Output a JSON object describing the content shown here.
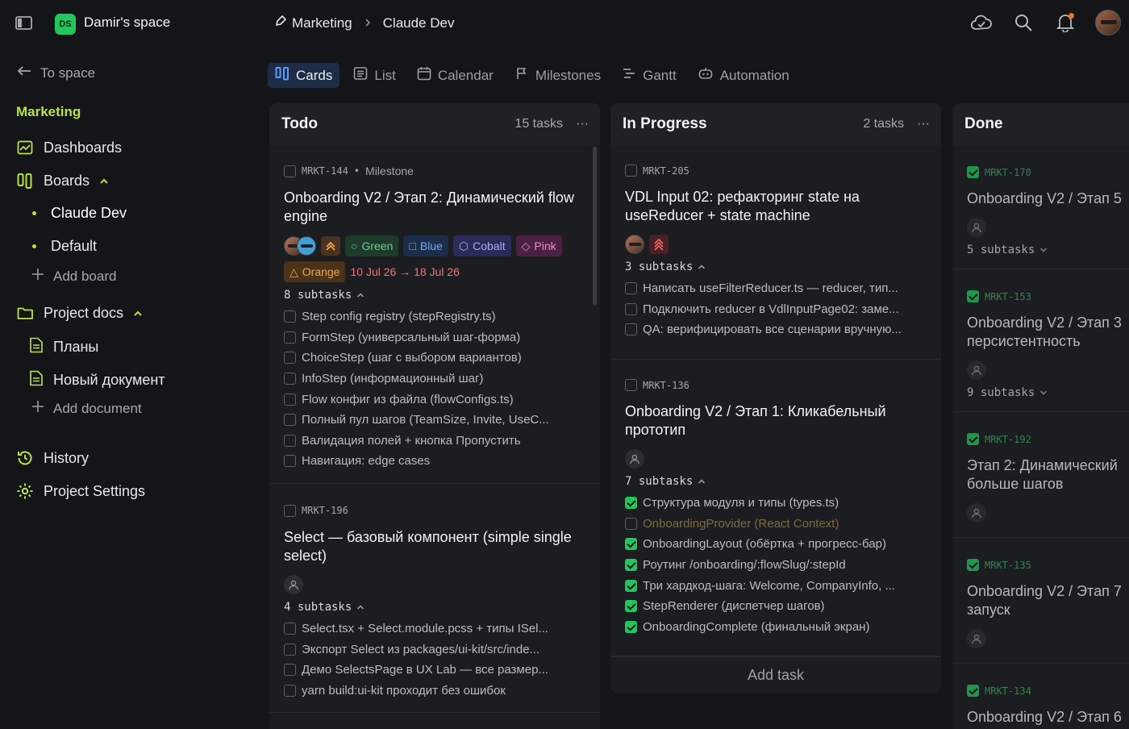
{
  "header": {
    "space_badge": "DS",
    "space_name": "Damir's space",
    "breadcrumb": [
      "Marketing",
      "Claude Dev"
    ]
  },
  "sidebar": {
    "back": "To space",
    "project": "Marketing",
    "dashboards": "Dashboards",
    "boards": "Boards",
    "boards_items": [
      "Claude Dev",
      "Default"
    ],
    "add_board": "Add board",
    "docs": "Project docs",
    "docs_items": [
      "Планы",
      "Новый документ"
    ],
    "add_document": "Add document",
    "history": "History",
    "settings": "Project Settings"
  },
  "tabs": [
    "Cards",
    "List",
    "Calendar",
    "Milestones",
    "Gantt",
    "Automation"
  ],
  "columns": {
    "todo": {
      "title": "Todo",
      "count": "15 tasks",
      "cards": [
        {
          "id": "MRKT-144",
          "milestone": "Milestone",
          "title": "Onboarding V2 / Этап 2: Динамический flow engine",
          "tags": [
            "Green",
            "Blue",
            "Cobalt",
            "Pink",
            "Orange"
          ],
          "dates": "10 Jul 26 → 18 Jul 26",
          "subtasks_label": "8 subtasks",
          "subtasks": [
            "Step config registry (stepRegistry.ts)",
            "FormStep (универсальный шаг-форма)",
            "ChoiceStep (шаг с выбором вариантов)",
            "InfoStep (информационный шаг)",
            "Flow конфиг из файла (flowConfigs.ts)",
            "Полный пул шагов (TeamSize, Invite, UseC...",
            "Валидация полей + кнопка Пропустить",
            "Навигация: edge cases"
          ]
        },
        {
          "id": "MRKT-196",
          "title": "Select — базовый компонент (simple single select)",
          "subtasks_label": "4 subtasks",
          "subtasks": [
            "Select.tsx + Select.module.pcss + типы ISel...",
            "Экспорт Select из packages/ui-kit/src/inde...",
            "Демо SelectsPage в UX Lab — все размер...",
            "yarn build:ui-kit проходит без ошибок"
          ]
        }
      ]
    },
    "progress": {
      "title": "In Progress",
      "count": "2 tasks",
      "add_task": "Add task",
      "cards": [
        {
          "id": "MRKT-205",
          "title": "VDL Input 02: рефакторинг state на useReducer + state machine",
          "subtasks_label": "3 subtasks",
          "subtasks": [
            "Написать useFilterReducer.ts — reducer, тип...",
            "Подключить reducer в VdlInputPage02: заме...",
            "QA: верифицировать все сценарии вручную..."
          ]
        },
        {
          "id": "MRKT-136",
          "title": "Onboarding V2 / Этап 1: Кликабельный прототип",
          "subtasks_label": "7 subtasks",
          "subtasks": [
            "Структура модуля и типы (types.ts)",
            "OnboardingProvider (React Context)",
            "OnboardingLayout (обёртка + прогресс-бар)",
            "Роутинг /onboarding/:flowSlug/:stepId",
            "Три хардкод-шага: Welcome, CompanyInfo, ...",
            "StepRenderer (диспетчер шагов)",
            "OnboardingComplete (финальный экран)"
          ]
        }
      ]
    },
    "done": {
      "title": "Done",
      "cards": [
        {
          "id": "MRKT-170",
          "title": "Onboarding V2 / Этап 5",
          "subtasks_label": "5 subtasks"
        },
        {
          "id": "MRKT-153",
          "title": "Onboarding V2 / Этап 3 персистентность",
          "subtasks_label": "9 subtasks"
        },
        {
          "id": "MRKT-192",
          "title": "Этап 2: Динамический больше шагов"
        },
        {
          "id": "MRKT-135",
          "title": "Onboarding V2 / Этап 7 запуск"
        },
        {
          "id": "MRKT-134",
          "title": "Onboarding V2 / Этап 6"
        }
      ]
    }
  },
  "colors": {
    "accent": "#b7e34a",
    "green": "#22c55e",
    "danger": "#f87171"
  },
  "icons": [
    "sidebar-toggle-icon",
    "cloud-check-icon",
    "search-icon",
    "bell-icon",
    "arrow-left-icon",
    "chart-icon",
    "board-icon",
    "folder-icon",
    "doc-icon",
    "history-icon",
    "gear-icon"
  ]
}
